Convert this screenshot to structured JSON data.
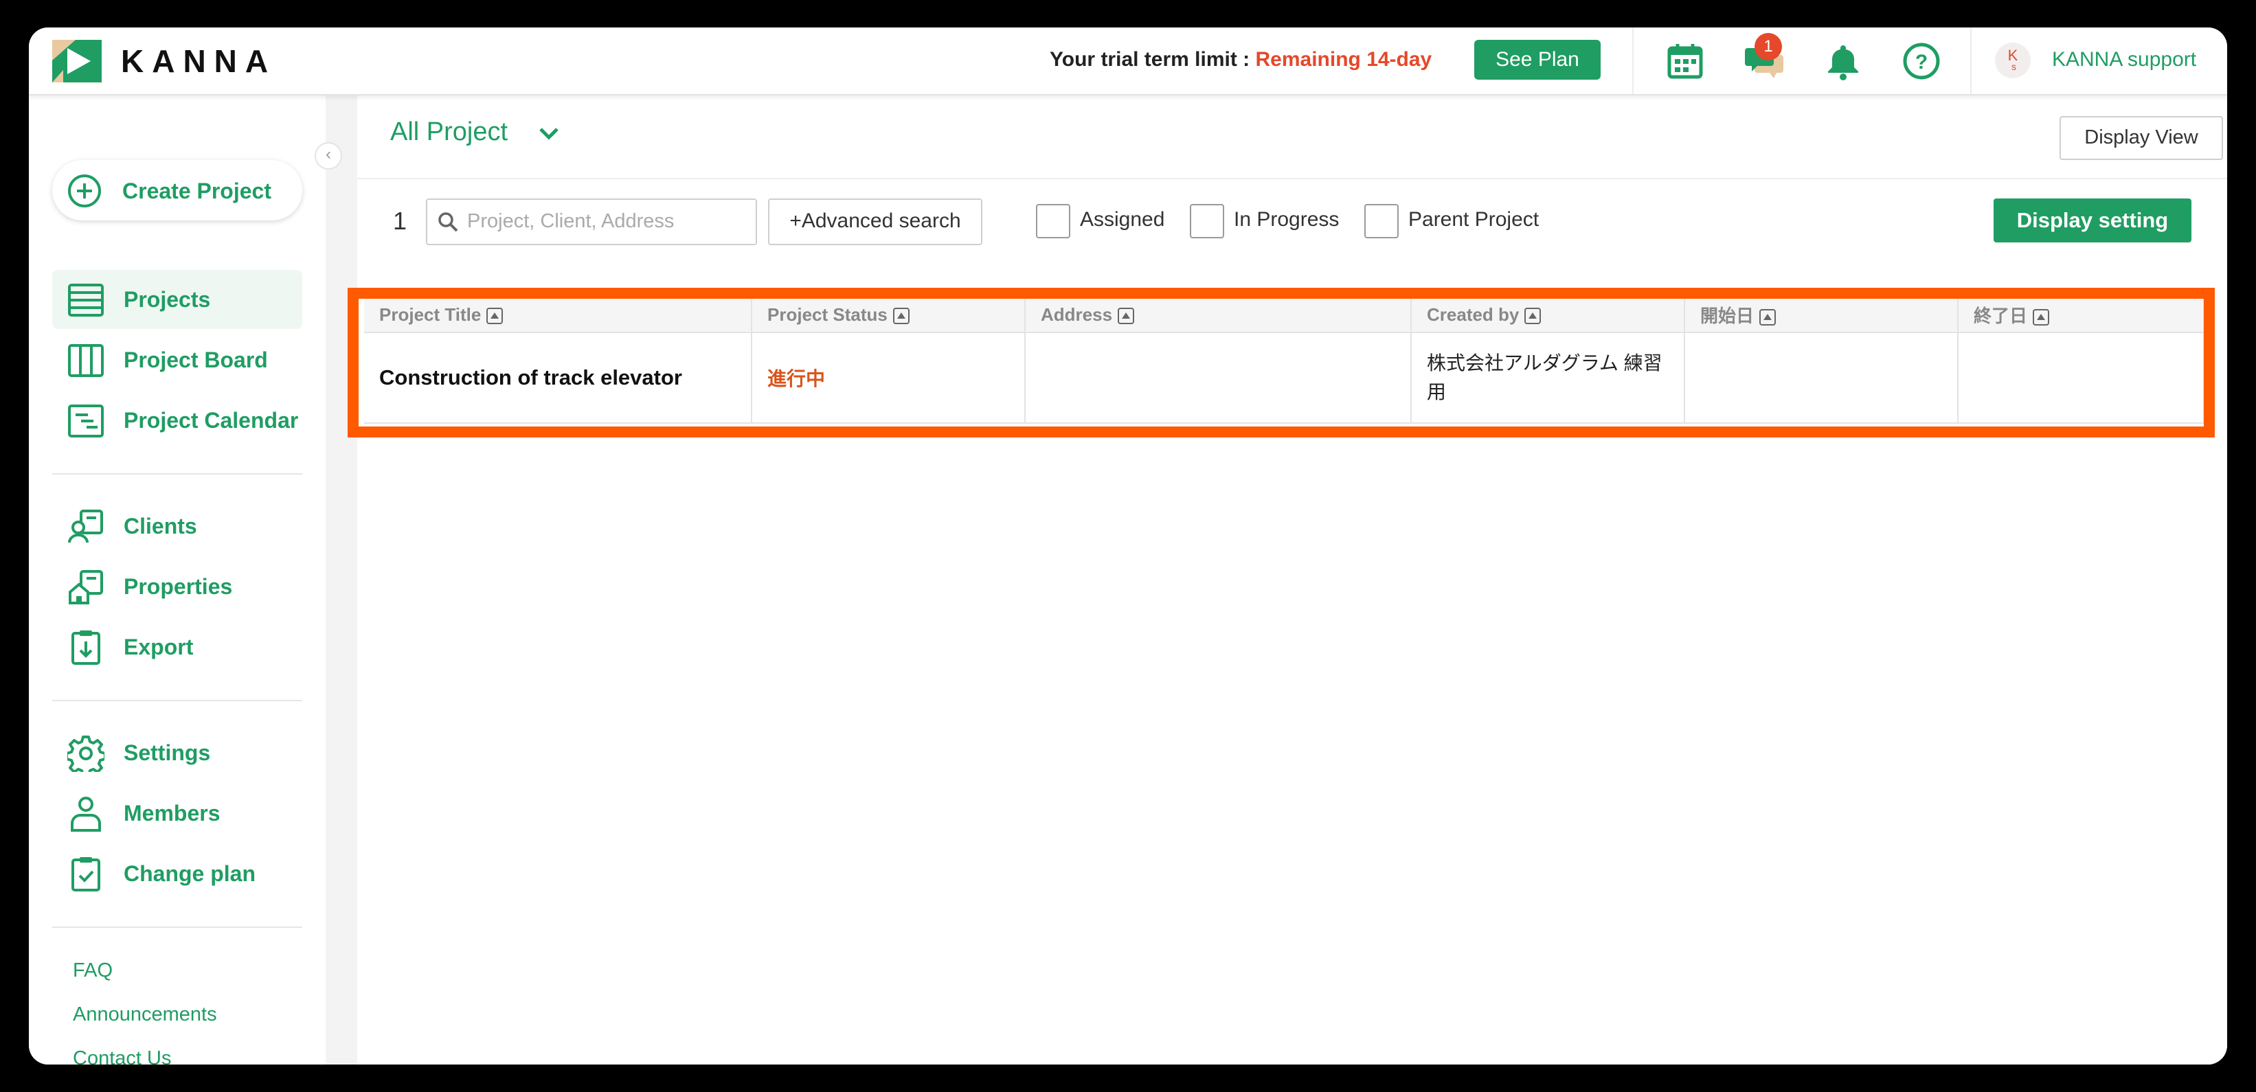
{
  "app": {
    "logo_text": "KANNA"
  },
  "topbar": {
    "trial_label": "Your trial term limit : ",
    "trial_remaining": "Remaining 14-day",
    "see_plan": "See Plan",
    "chat_badge": "1",
    "avatar_initial": "K",
    "avatar_sub": "s",
    "user_name": "KANNA support"
  },
  "sidebar": {
    "collapse": "‹",
    "create_project": "Create Project",
    "items": [
      {
        "label": "Projects",
        "icon": "list-icon"
      },
      {
        "label": "Project Board",
        "icon": "board-icon"
      },
      {
        "label": "Project Calendar",
        "icon": "calendar-icon"
      },
      {
        "label": "Clients",
        "icon": "client-icon"
      },
      {
        "label": "Properties",
        "icon": "property-icon"
      },
      {
        "label": "Export",
        "icon": "export-icon"
      },
      {
        "label": "Settings",
        "icon": "gear-icon"
      },
      {
        "label": "Members",
        "icon": "person-icon"
      },
      {
        "label": "Change plan",
        "icon": "clipboard-check-icon"
      }
    ],
    "links": [
      "FAQ",
      "Announcements",
      "Contact Us"
    ]
  },
  "main": {
    "view_title": "All Project",
    "display_view": "Display View",
    "count": "1",
    "search_placeholder": "Project, Client, Address",
    "advanced_search": "Advanced search",
    "filters": [
      "Assigned",
      "In Progress",
      "Parent Project"
    ],
    "display_setting": "Display setting",
    "table": {
      "columns": [
        "Project Title",
        "Project Status",
        "Address",
        "Created by",
        "開始日",
        "終了日"
      ],
      "rows": [
        [
          "Construction of track elevator",
          "進行中",
          "",
          "株式会社アルダグラム 練習用",
          "",
          ""
        ]
      ]
    }
  },
  "colors": {
    "brand": "#1f9d63",
    "alert": "#e5482a",
    "highlight": "#ff5a00"
  }
}
